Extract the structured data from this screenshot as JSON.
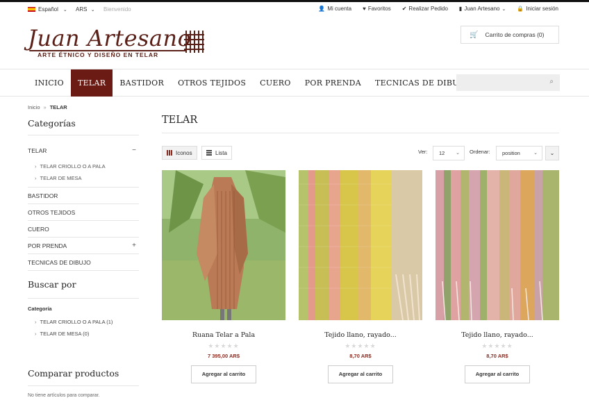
{
  "topbar": {
    "language": "Español",
    "currency": "ARS",
    "welcome": "Bienvenido",
    "links": [
      {
        "icon": "user-icon",
        "glyph": "👤",
        "label": "Mi cuenta"
      },
      {
        "icon": "heart-icon",
        "glyph": "♥",
        "label": "Favoritos"
      },
      {
        "icon": "check-icon",
        "glyph": "✔",
        "label": "Realizar Pedido"
      },
      {
        "icon": "document-icon",
        "glyph": "▮",
        "label": "Juan Artesano"
      },
      {
        "icon": "lock-icon",
        "glyph": "🔒",
        "label": "Iniciar sesión"
      }
    ]
  },
  "logo": {
    "name": "Juan Artesano",
    "tagline": "ARTE ÉTNICO Y DISEÑO EN TELAR"
  },
  "cart": {
    "label": "Carrito de compras (0)"
  },
  "nav": {
    "items": [
      "INICIO",
      "TELAR",
      "BASTIDOR",
      "OTROS TEJIDOS",
      "CUERO",
      "POR PRENDA",
      "TECNICAS DE DIBUJO"
    ],
    "active_index": 1,
    "search_placeholder": ""
  },
  "breadcrumb": {
    "home": "Inicio",
    "current": "TELAR"
  },
  "sidebar": {
    "categories_title": "Categorías",
    "categories": [
      {
        "label": "TELAR",
        "toggle": "−"
      },
      {
        "label": "BASTIDOR",
        "toggle": ""
      },
      {
        "label": "OTROS TEJIDOS",
        "toggle": ""
      },
      {
        "label": "CUERO",
        "toggle": ""
      },
      {
        "label": "POR PRENDA",
        "toggle": "+"
      },
      {
        "label": "TECNICAS DE DIBUJO",
        "toggle": ""
      }
    ],
    "subcategories": [
      "TELAR CRIOLLO O A PALA",
      "TELAR DE MESA"
    ],
    "filter_title": "Buscar por",
    "filter_group": "Categoría",
    "filter_items": [
      "TELAR CRIOLLO O A PALA (1)",
      "TELAR DE MESA (0)"
    ],
    "compare_title": "Comparar productos",
    "compare_text": "No tiene artículos para comparar."
  },
  "main": {
    "title": "TELAR",
    "view_grid": "Iconos",
    "view_list": "Lista",
    "per_page_label": "Ver:",
    "per_page_value": "12",
    "sort_label": "Ordenar:",
    "sort_value": "position"
  },
  "products": [
    {
      "name": "Ruana Telar a Pala",
      "price": "7 395,00 AR$",
      "button": "Agregar al carrito",
      "stars": "★★★★★"
    },
    {
      "name": "Tejido llano, rayado...",
      "price": "8,70 AR$",
      "button": "Agregar al carrito",
      "stars": "★★★★★"
    },
    {
      "name": "Tejido llano, rayado...",
      "price": "8,70 AR$",
      "button": "Agregar al carrito",
      "stars": "★★★★★"
    }
  ],
  "colors": {
    "brand": "#6b1a14",
    "price": "#8a2a1f"
  }
}
